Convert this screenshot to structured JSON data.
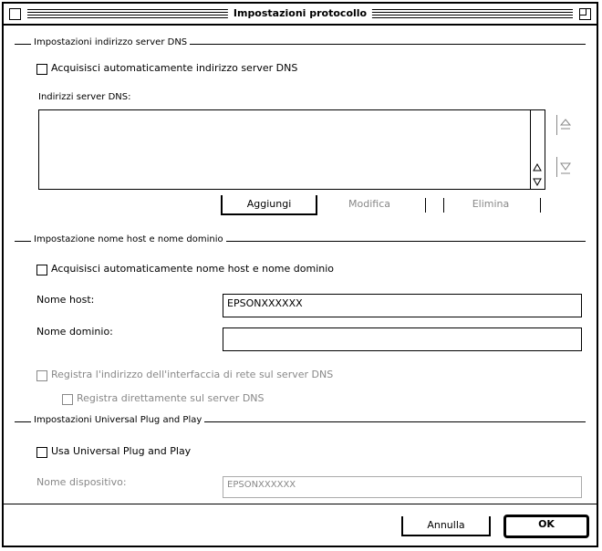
{
  "window": {
    "title": "Impostazioni protocollo"
  },
  "dns": {
    "legend": "Impostazioni indirizzo server DNS",
    "auto_label": "Acquisisci automaticamente indirizzo server DNS",
    "list_label": "Indirizzi server DNS:",
    "add_label": "Aggiungi",
    "edit_label": "Modifica",
    "remove_label": "Elimina"
  },
  "host": {
    "legend": "Impostazione nome host e nome dominio",
    "auto_label": "Acquisisci automaticamente nome host e nome dominio",
    "hostname_label": "Nome host:",
    "hostname_value": "EPSONXXXXXX",
    "domain_label": "Nome dominio:",
    "domain_value": "",
    "register_label": "Registra l'indirizzo dell'interfaccia di rete sul server DNS",
    "register_direct_label": "Registra direttamente sul server DNS"
  },
  "upnp": {
    "legend": "Impostazioni Universal Plug and Play",
    "use_label": "Usa Universal Plug and Play",
    "device_label": "Nome dispositivo:",
    "device_value": "EPSONXXXXXX"
  },
  "footer": {
    "cancel_label": "Annulla",
    "ok_label": "OK"
  }
}
